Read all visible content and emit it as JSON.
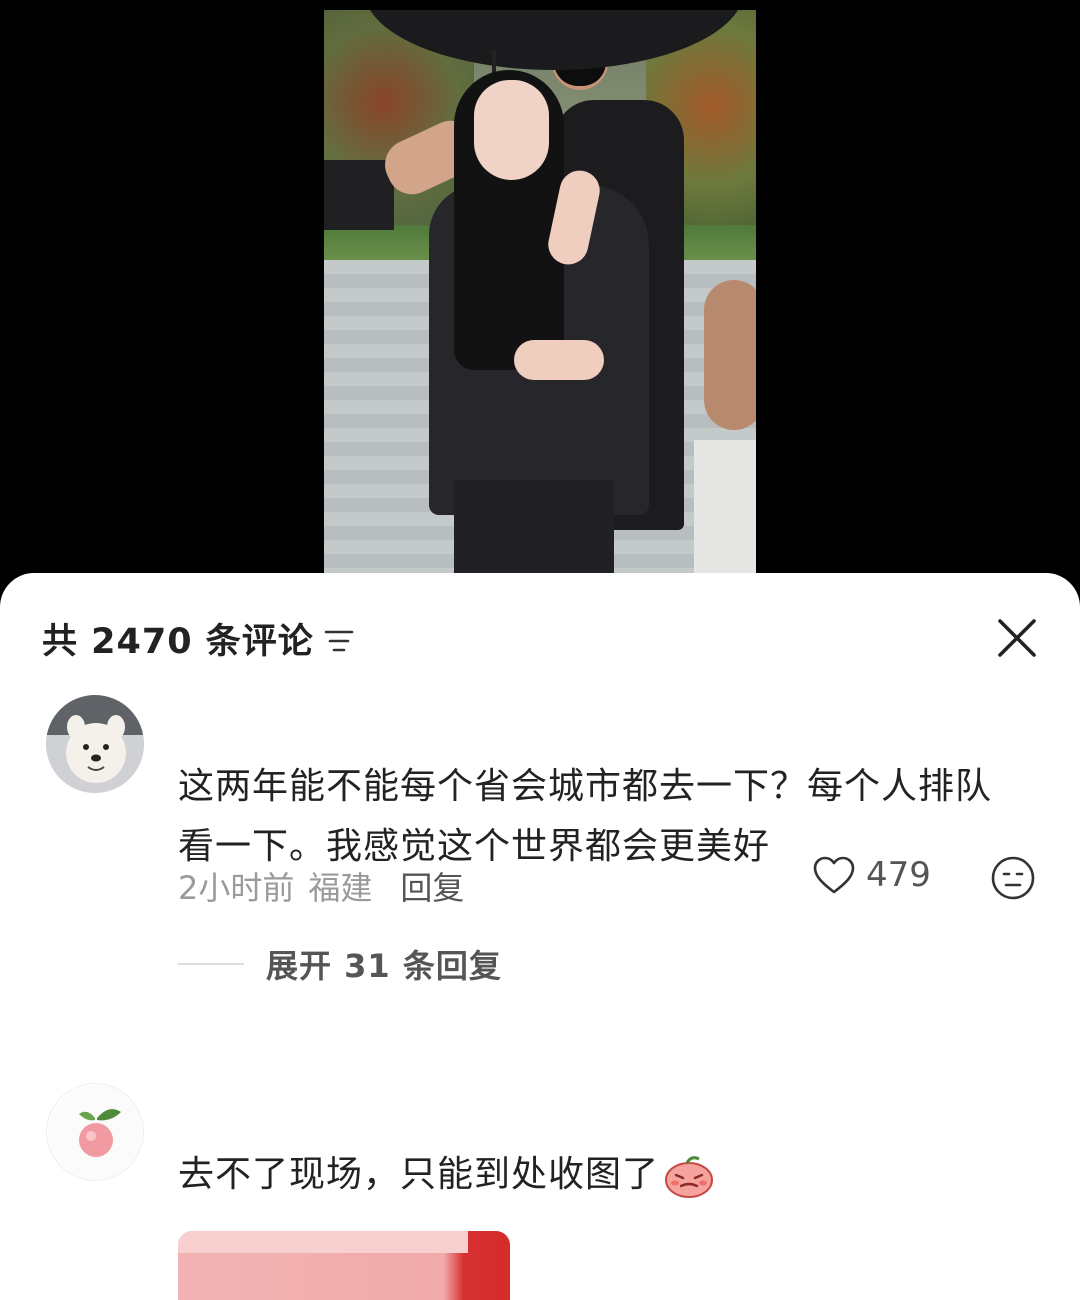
{
  "comments_panel": {
    "count_label": "共 2470 条评论",
    "icons": {
      "sort": "sort-lines-icon",
      "close": "close-x-icon"
    }
  },
  "comments": [
    {
      "text": "这两年能不能每个省会城市都去一下？每个人排队看一下。我感觉这个世界都会更美好",
      "time": "2小时前",
      "location": "福建",
      "reply_label": "回复",
      "likes": "479",
      "expand_label": "展开 31 条回复",
      "icons": {
        "avatar": "white-dog-avatar",
        "like": "heart-outline-icon",
        "react": "neutral-face-icon"
      }
    },
    {
      "text": "去不了现场，只能到处收图了",
      "icons": {
        "avatar": "peach-avatar",
        "sticker": "crying-peach-sticker"
      }
    }
  ],
  "colors": {
    "panel_bg": "#ffffff",
    "text": "#222222",
    "meta": "#9a9a9a",
    "backdrop": "#000000"
  }
}
